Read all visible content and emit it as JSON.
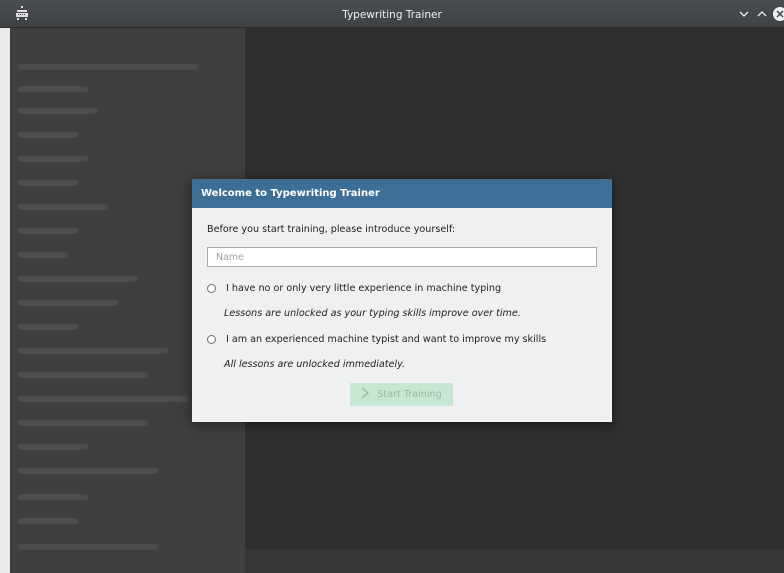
{
  "window": {
    "title": "Typewriting Trainer"
  },
  "dialog": {
    "header": "Welcome to Typewriting Trainer",
    "intro": "Before you start training, please introduce yourself:",
    "name_placeholder": "Name",
    "name_value": "",
    "option_beginner": {
      "label": "I have no or only very little experience in machine typing",
      "hint": "Lessons are unlocked as your typing skills improve over time."
    },
    "option_experienced": {
      "label": "I am an experienced machine typist and want to improve my skills",
      "hint": "All lessons are unlocked immediately."
    },
    "start_button": "Start Training",
    "start_button_enabled": false
  },
  "colors": {
    "header": "#3d6e96",
    "dialog_bg": "#eff0f1",
    "start_button_bg": "#c7e6d3"
  }
}
